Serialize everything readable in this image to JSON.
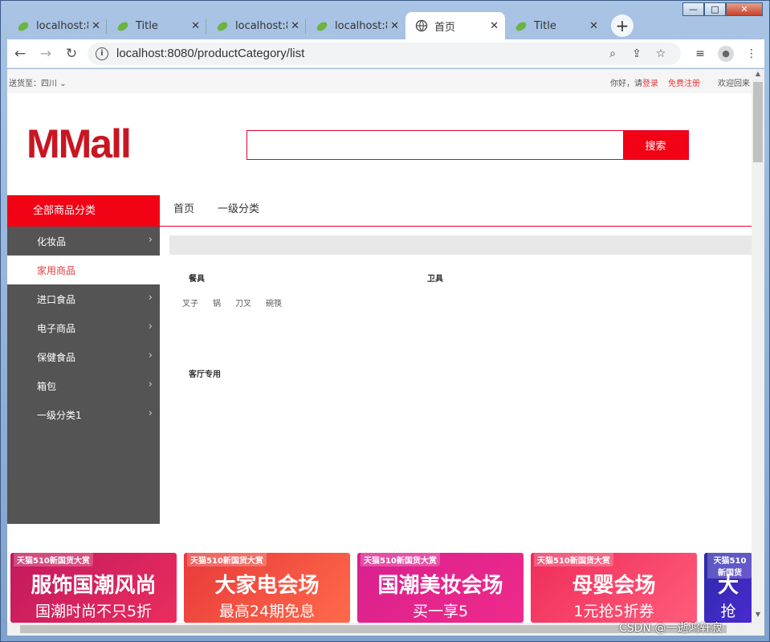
{
  "window": {
    "minimize": "—",
    "maximize": "□",
    "close": "✕"
  },
  "tabs": [
    {
      "title": "localhost:8",
      "icon": "leaf-icon",
      "active": false
    },
    {
      "title": "Title",
      "icon": "leaf-icon",
      "active": false
    },
    {
      "title": "localhost:8",
      "icon": "leaf-icon",
      "active": false
    },
    {
      "title": "localhost:8",
      "icon": "leaf-icon",
      "active": false
    },
    {
      "title": "首页",
      "icon": "globe-icon",
      "active": true
    },
    {
      "title": "Title",
      "icon": "leaf-icon",
      "active": false
    }
  ],
  "tab_close": "✕",
  "new_tab": "+",
  "address": {
    "url": "localhost:8080/productCategory/list"
  },
  "topbar": {
    "location_label": "送货至：四川",
    "greeting": "你好，请",
    "login": "登录",
    "register": "免费注册",
    "welcome": "欢迎回来"
  },
  "logo": "MMall",
  "search": {
    "value": "",
    "button": "搜索"
  },
  "nav": {
    "all_categories": "全部商品分类",
    "links": [
      "首页",
      "一级分类"
    ]
  },
  "sidebar": [
    {
      "label": "化妆品",
      "active": false
    },
    {
      "label": "家用商品",
      "active": true
    },
    {
      "label": "进口食品",
      "active": false
    },
    {
      "label": "电子商品",
      "active": false
    },
    {
      "label": "保健食品",
      "active": false
    },
    {
      "label": "箱包",
      "active": false
    },
    {
      "label": "一级分类1",
      "active": false
    }
  ],
  "groups": [
    {
      "title": "餐具",
      "items": [
        "叉子",
        "锅",
        "刀叉",
        "碗筷"
      ]
    },
    {
      "title": "卫具",
      "items": []
    },
    {
      "title": "客厅专用",
      "items": []
    }
  ],
  "banners": [
    {
      "tag": "天猫510新国货大赏",
      "big": "服饰国潮风尚",
      "small": "国潮时尚不只5折"
    },
    {
      "tag": "天猫510新国货大赏",
      "big": "大家电会场",
      "small": "最高24期免息"
    },
    {
      "tag": "天猫510新国货大赏",
      "big": "国潮美妆会场",
      "small": "买一享5"
    },
    {
      "tag": "天猫510新国货大赏",
      "big": "母婴会场",
      "small": "1元抢5折券"
    },
    {
      "tag": "天猫510新国货",
      "big": "大",
      "small": "抢"
    }
  ],
  "watermark": "CSDN @一逝鸿轩寂"
}
